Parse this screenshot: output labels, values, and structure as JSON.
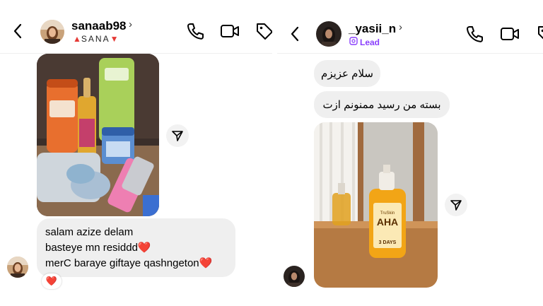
{
  "left_chat": {
    "header": {
      "username": "sanaab98",
      "chevron": "›",
      "subtitle_pre": "▲",
      "subtitle_text": "SANA",
      "subtitle_post": "▼"
    },
    "message": {
      "lines": [
        "salam azize delam",
        "basteye mn residdd❤️",
        "merC baraye giftaye qashngeton❤️"
      ],
      "reaction": "❤️"
    }
  },
  "right_chat": {
    "header": {
      "username": "_yasii_n",
      "chevron": "›",
      "label": "Lead"
    },
    "messages": [
      "سلام عزیزم",
      "بسته من رسید ممنونم ازت"
    ],
    "product_label": {
      "brand": "TruSkin",
      "name": "AHA",
      "tagline": "3 DAYS"
    }
  },
  "colors": {
    "bubble": "#efefef",
    "lead_purple": "#8a3ffc",
    "heart_red": "#e0001b"
  },
  "icons": [
    "back-arrow-icon",
    "phone-icon",
    "video-call-icon",
    "tag-icon",
    "send-share-icon",
    "lead-badge-icon"
  ]
}
